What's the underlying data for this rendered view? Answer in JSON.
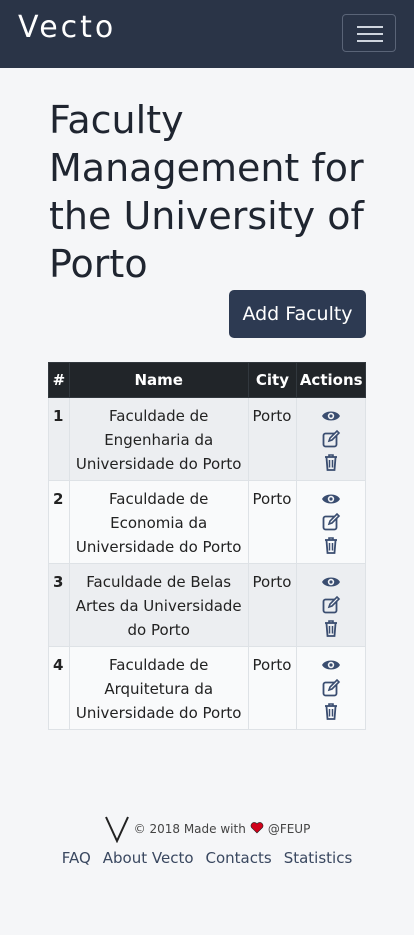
{
  "navbar": {
    "brand": "Vecto",
    "menu_icon": "hamburger-icon"
  },
  "page": {
    "title": "Faculty Management for the University of Porto"
  },
  "add_button": {
    "label": "Add Faculty"
  },
  "table": {
    "headers": [
      "#",
      "Name",
      "City",
      "Actions"
    ],
    "rows": [
      {
        "num": "1",
        "name": "Faculdade de Engenharia da Universidade do Porto",
        "city": "Porto"
      },
      {
        "num": "2",
        "name": "Faculdade de Economia da Universidade do Porto",
        "city": "Porto"
      },
      {
        "num": "3",
        "name": "Faculdade de Belas Artes da Universidade do Porto",
        "city": "Porto"
      },
      {
        "num": "4",
        "name": "Faculdade de Arquitetura da Universidade do Porto",
        "city": "Porto"
      }
    ],
    "action_icons": [
      "eye-icon",
      "edit-icon",
      "trash-icon"
    ],
    "icon_color": "#3a4d70"
  },
  "footer": {
    "copyright_pre": "© 2018 Made with",
    "copyright_post": "@FEUP",
    "heart_color": "#d0021b",
    "links": [
      "FAQ",
      "About Vecto",
      "Contacts",
      "Statistics"
    ]
  }
}
